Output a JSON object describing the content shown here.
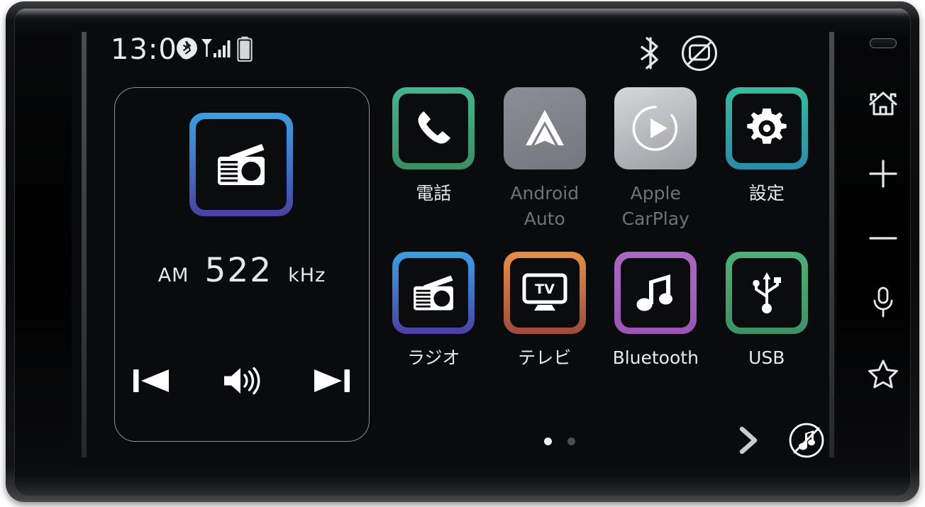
{
  "device": {
    "name": "car-head-unit",
    "indicator_name": "status-indicator-light"
  },
  "screen": {
    "background": "#0a0b0d"
  },
  "status_bar": {
    "time": "13:00",
    "left_icons": [
      {
        "name": "bluetooth-badge-icon",
        "label": "Bluetooth connected"
      },
      {
        "name": "cellular-signal-icon",
        "label": "Signal strength"
      },
      {
        "name": "battery-icon",
        "label": "Battery"
      }
    ],
    "right_icons": [
      {
        "name": "bluetooth-icon",
        "label": "Bluetooth"
      },
      {
        "name": "display-off-icon",
        "label": "Display off"
      }
    ]
  },
  "media_panel": {
    "source_icon": "radio-icon",
    "source_accent": "#3a9fe3",
    "band": "AM",
    "frequency": "522",
    "unit": "kHz",
    "controls": [
      {
        "name": "previous-track-button",
        "label": "Previous"
      },
      {
        "name": "volume-button",
        "label": "Volume"
      },
      {
        "name": "next-track-button",
        "label": "Next"
      }
    ]
  },
  "app_grid": {
    "apps": [
      {
        "id": "phone",
        "label": "電話",
        "icon": "phone-icon",
        "style": "g-phone",
        "disabled": false,
        "accent": "#41b68d"
      },
      {
        "id": "android-auto",
        "label": "Android\nAuto",
        "icon": "android-auto-icon",
        "style": "g-aauto",
        "disabled": true,
        "accent": "#8b8e94"
      },
      {
        "id": "apple-carplay",
        "label": "Apple\nCarPlay",
        "icon": "apple-carplay-icon",
        "style": "g-carplay",
        "disabled": true,
        "accent": "#d6d8db"
      },
      {
        "id": "settings",
        "label": "設定",
        "icon": "gear-icon",
        "style": "g-settings",
        "disabled": false,
        "accent": "#36bb9d"
      },
      {
        "id": "radio",
        "label": "ラジオ",
        "icon": "radio-icon",
        "style": "g-radio",
        "disabled": false,
        "accent": "#3a9fe3"
      },
      {
        "id": "tv",
        "label": "テレビ",
        "icon": "tv-icon",
        "style": "g-tv",
        "disabled": false,
        "accent": "#e58f45"
      },
      {
        "id": "bluetooth",
        "label": "Bluetooth",
        "icon": "music-note-icon",
        "style": "g-bt",
        "disabled": false,
        "accent": "#ab68c3"
      },
      {
        "id": "usb",
        "label": "USB",
        "icon": "usb-icon",
        "style": "g-usb",
        "disabled": false,
        "accent": "#4cb276"
      }
    ]
  },
  "bottom_bar": {
    "page_count": 2,
    "active_page": 1,
    "next_page_label": ">",
    "mute_icon": "mute-music-icon"
  },
  "hardware_buttons": [
    {
      "id": "home",
      "name": "home-button",
      "label": "Home"
    },
    {
      "id": "volume-up",
      "name": "volume-up-button",
      "label": "Volume up"
    },
    {
      "id": "volume-down",
      "name": "volume-down-button",
      "label": "Volume down"
    },
    {
      "id": "voice",
      "name": "microphone-button",
      "label": "Voice"
    },
    {
      "id": "favorite",
      "name": "star-button",
      "label": "Favorite"
    }
  ]
}
